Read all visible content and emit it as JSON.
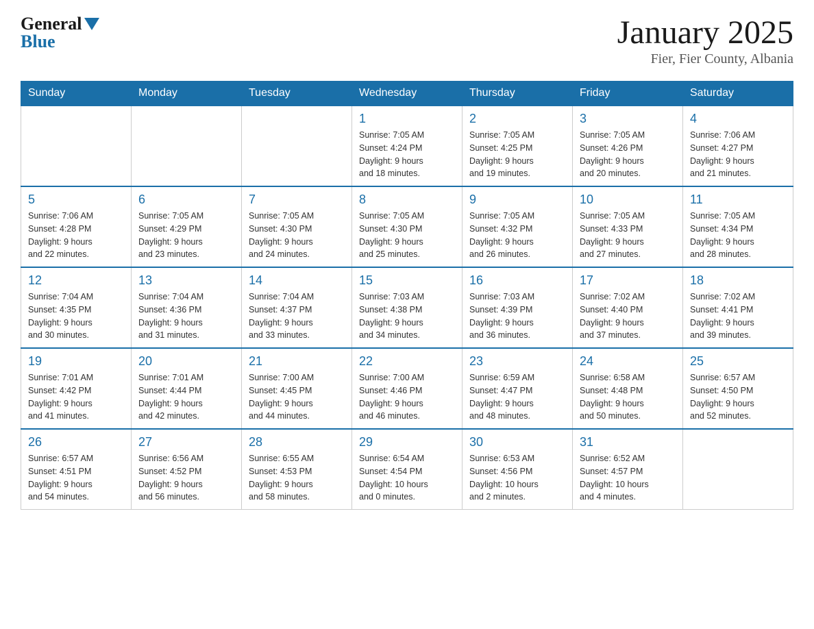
{
  "header": {
    "logo_general": "General",
    "logo_blue": "Blue",
    "month": "January 2025",
    "location": "Fier, Fier County, Albania"
  },
  "days_of_week": [
    "Sunday",
    "Monday",
    "Tuesday",
    "Wednesday",
    "Thursday",
    "Friday",
    "Saturday"
  ],
  "weeks": [
    [
      {
        "day": "",
        "info": ""
      },
      {
        "day": "",
        "info": ""
      },
      {
        "day": "",
        "info": ""
      },
      {
        "day": "1",
        "info": "Sunrise: 7:05 AM\nSunset: 4:24 PM\nDaylight: 9 hours\nand 18 minutes."
      },
      {
        "day": "2",
        "info": "Sunrise: 7:05 AM\nSunset: 4:25 PM\nDaylight: 9 hours\nand 19 minutes."
      },
      {
        "day": "3",
        "info": "Sunrise: 7:05 AM\nSunset: 4:26 PM\nDaylight: 9 hours\nand 20 minutes."
      },
      {
        "day": "4",
        "info": "Sunrise: 7:06 AM\nSunset: 4:27 PM\nDaylight: 9 hours\nand 21 minutes."
      }
    ],
    [
      {
        "day": "5",
        "info": "Sunrise: 7:06 AM\nSunset: 4:28 PM\nDaylight: 9 hours\nand 22 minutes."
      },
      {
        "day": "6",
        "info": "Sunrise: 7:05 AM\nSunset: 4:29 PM\nDaylight: 9 hours\nand 23 minutes."
      },
      {
        "day": "7",
        "info": "Sunrise: 7:05 AM\nSunset: 4:30 PM\nDaylight: 9 hours\nand 24 minutes."
      },
      {
        "day": "8",
        "info": "Sunrise: 7:05 AM\nSunset: 4:30 PM\nDaylight: 9 hours\nand 25 minutes."
      },
      {
        "day": "9",
        "info": "Sunrise: 7:05 AM\nSunset: 4:32 PM\nDaylight: 9 hours\nand 26 minutes."
      },
      {
        "day": "10",
        "info": "Sunrise: 7:05 AM\nSunset: 4:33 PM\nDaylight: 9 hours\nand 27 minutes."
      },
      {
        "day": "11",
        "info": "Sunrise: 7:05 AM\nSunset: 4:34 PM\nDaylight: 9 hours\nand 28 minutes."
      }
    ],
    [
      {
        "day": "12",
        "info": "Sunrise: 7:04 AM\nSunset: 4:35 PM\nDaylight: 9 hours\nand 30 minutes."
      },
      {
        "day": "13",
        "info": "Sunrise: 7:04 AM\nSunset: 4:36 PM\nDaylight: 9 hours\nand 31 minutes."
      },
      {
        "day": "14",
        "info": "Sunrise: 7:04 AM\nSunset: 4:37 PM\nDaylight: 9 hours\nand 33 minutes."
      },
      {
        "day": "15",
        "info": "Sunrise: 7:03 AM\nSunset: 4:38 PM\nDaylight: 9 hours\nand 34 minutes."
      },
      {
        "day": "16",
        "info": "Sunrise: 7:03 AM\nSunset: 4:39 PM\nDaylight: 9 hours\nand 36 minutes."
      },
      {
        "day": "17",
        "info": "Sunrise: 7:02 AM\nSunset: 4:40 PM\nDaylight: 9 hours\nand 37 minutes."
      },
      {
        "day": "18",
        "info": "Sunrise: 7:02 AM\nSunset: 4:41 PM\nDaylight: 9 hours\nand 39 minutes."
      }
    ],
    [
      {
        "day": "19",
        "info": "Sunrise: 7:01 AM\nSunset: 4:42 PM\nDaylight: 9 hours\nand 41 minutes."
      },
      {
        "day": "20",
        "info": "Sunrise: 7:01 AM\nSunset: 4:44 PM\nDaylight: 9 hours\nand 42 minutes."
      },
      {
        "day": "21",
        "info": "Sunrise: 7:00 AM\nSunset: 4:45 PM\nDaylight: 9 hours\nand 44 minutes."
      },
      {
        "day": "22",
        "info": "Sunrise: 7:00 AM\nSunset: 4:46 PM\nDaylight: 9 hours\nand 46 minutes."
      },
      {
        "day": "23",
        "info": "Sunrise: 6:59 AM\nSunset: 4:47 PM\nDaylight: 9 hours\nand 48 minutes."
      },
      {
        "day": "24",
        "info": "Sunrise: 6:58 AM\nSunset: 4:48 PM\nDaylight: 9 hours\nand 50 minutes."
      },
      {
        "day": "25",
        "info": "Sunrise: 6:57 AM\nSunset: 4:50 PM\nDaylight: 9 hours\nand 52 minutes."
      }
    ],
    [
      {
        "day": "26",
        "info": "Sunrise: 6:57 AM\nSunset: 4:51 PM\nDaylight: 9 hours\nand 54 minutes."
      },
      {
        "day": "27",
        "info": "Sunrise: 6:56 AM\nSunset: 4:52 PM\nDaylight: 9 hours\nand 56 minutes."
      },
      {
        "day": "28",
        "info": "Sunrise: 6:55 AM\nSunset: 4:53 PM\nDaylight: 9 hours\nand 58 minutes."
      },
      {
        "day": "29",
        "info": "Sunrise: 6:54 AM\nSunset: 4:54 PM\nDaylight: 10 hours\nand 0 minutes."
      },
      {
        "day": "30",
        "info": "Sunrise: 6:53 AM\nSunset: 4:56 PM\nDaylight: 10 hours\nand 2 minutes."
      },
      {
        "day": "31",
        "info": "Sunrise: 6:52 AM\nSunset: 4:57 PM\nDaylight: 10 hours\nand 4 minutes."
      },
      {
        "day": "",
        "info": ""
      }
    ]
  ]
}
